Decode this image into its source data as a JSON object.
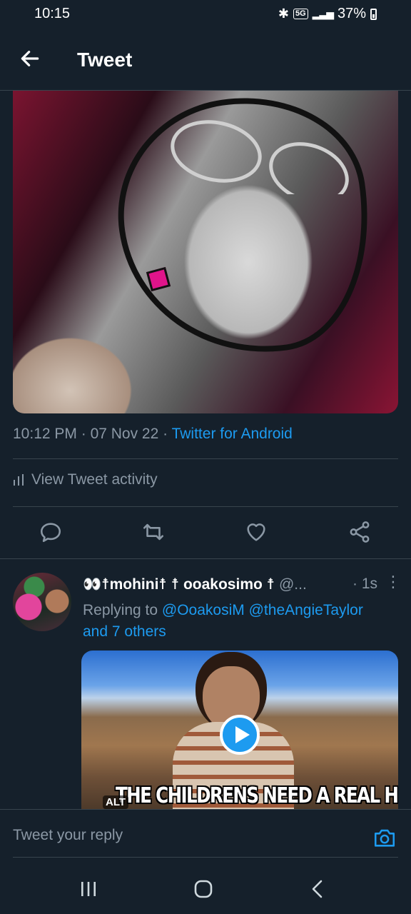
{
  "status_bar": {
    "time": "10:15",
    "network": "5G",
    "battery": "37%"
  },
  "header": {
    "title": "Tweet"
  },
  "tweet": {
    "time": "10:12 PM",
    "date": "07 Nov 22",
    "separator": " · ",
    "source": "Twitter for Android",
    "activity_label": "View Tweet activity"
  },
  "reply": {
    "name": "👀☨mohini☨ ☨ ooakosimo ☨",
    "handle": "@...",
    "ago": "· 1s",
    "replying_prefix": "Replying to ",
    "mention1": "@OoakosiM",
    "mention2": "@theAngieTaylor",
    "others": "and 7 others",
    "video_alt": "ALT",
    "video_caption": "THE CHILDRENS NEED A REAL HERO"
  },
  "composer": {
    "placeholder": "Tweet your reply"
  },
  "colors": {
    "background": "#15202b",
    "accent": "#1d9bf0",
    "muted": "#8b98a5",
    "divider": "#38444d"
  }
}
